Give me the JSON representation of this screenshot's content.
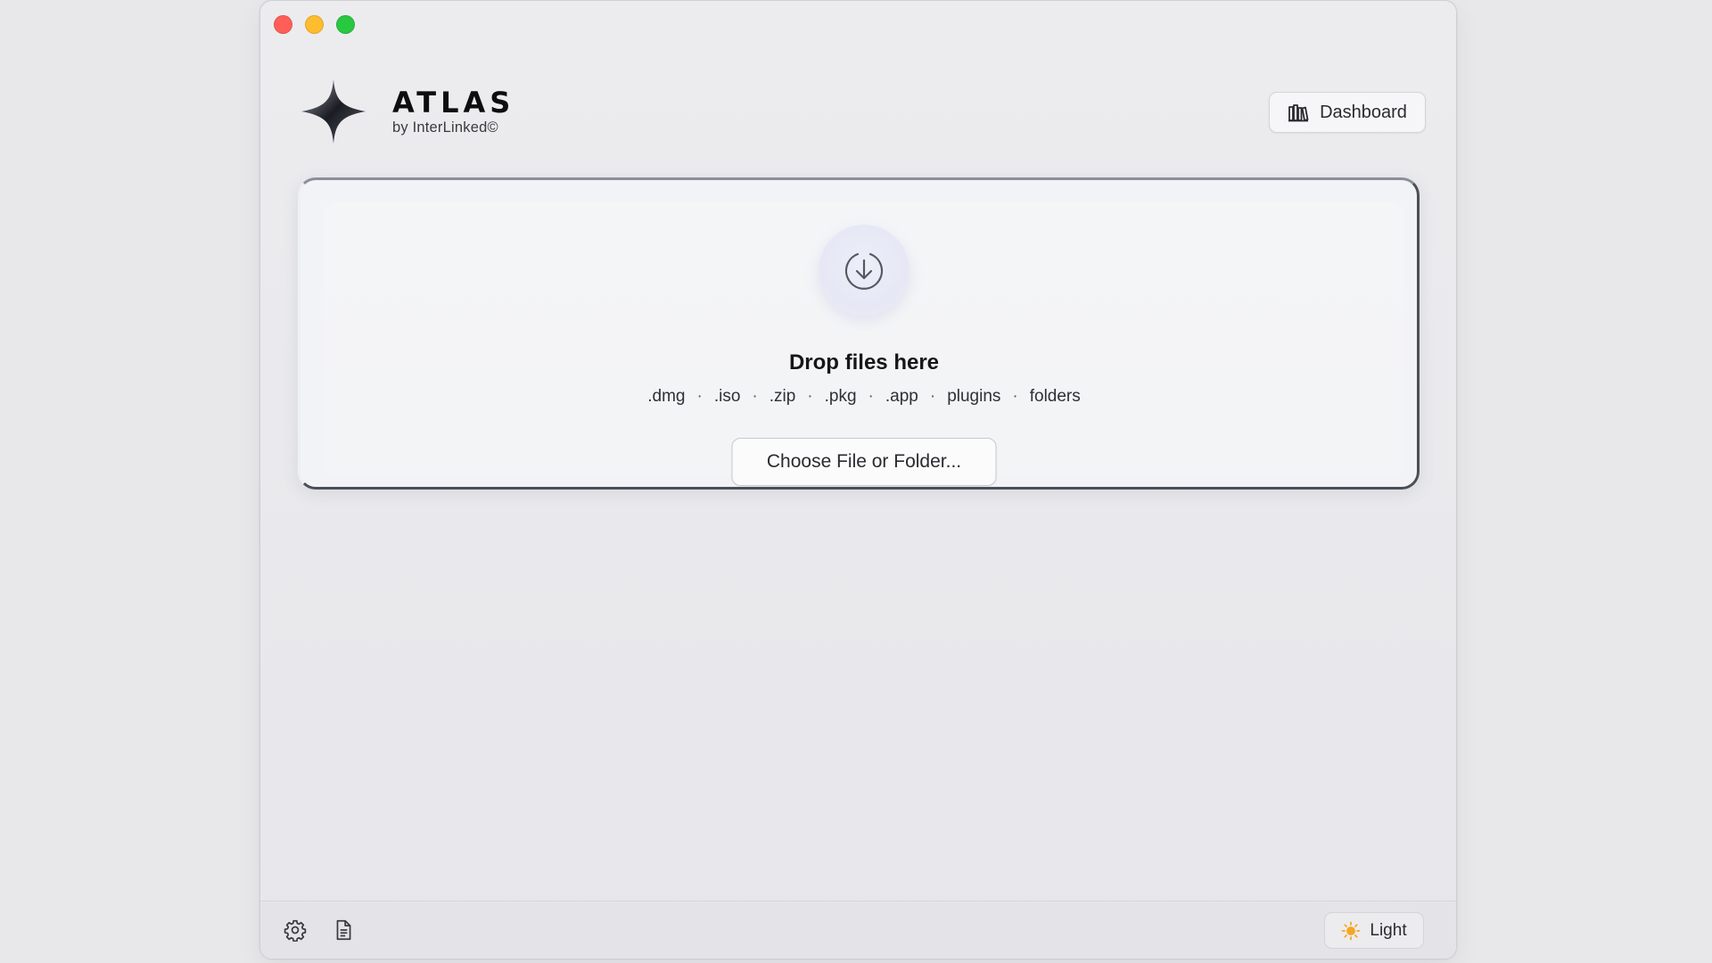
{
  "window": {
    "controls": [
      "close",
      "minimize",
      "zoom"
    ],
    "colors": {
      "close": "#ff5f57",
      "minimize": "#febc2e",
      "zoom": "#28c840"
    }
  },
  "header": {
    "brand_title": "ATLAS",
    "brand_subtitle": "by InterLinked©",
    "logo_icon": "sparkle-star-icon",
    "dashboard_label": "Dashboard",
    "dashboard_icon": "library-books-icon"
  },
  "dropzone": {
    "icon": "download-arrow-icon",
    "title": "Drop files here",
    "file_types": [
      ".dmg",
      ".iso",
      ".zip",
      ".pkg",
      ".app",
      "plugins",
      "folders"
    ],
    "choose_label": "Choose File or Folder..."
  },
  "footer": {
    "settings_icon": "gear-icon",
    "log_icon": "document-icon",
    "theme_label": "Light",
    "theme_icon": "sun-icon",
    "accent": "#f5a623"
  }
}
